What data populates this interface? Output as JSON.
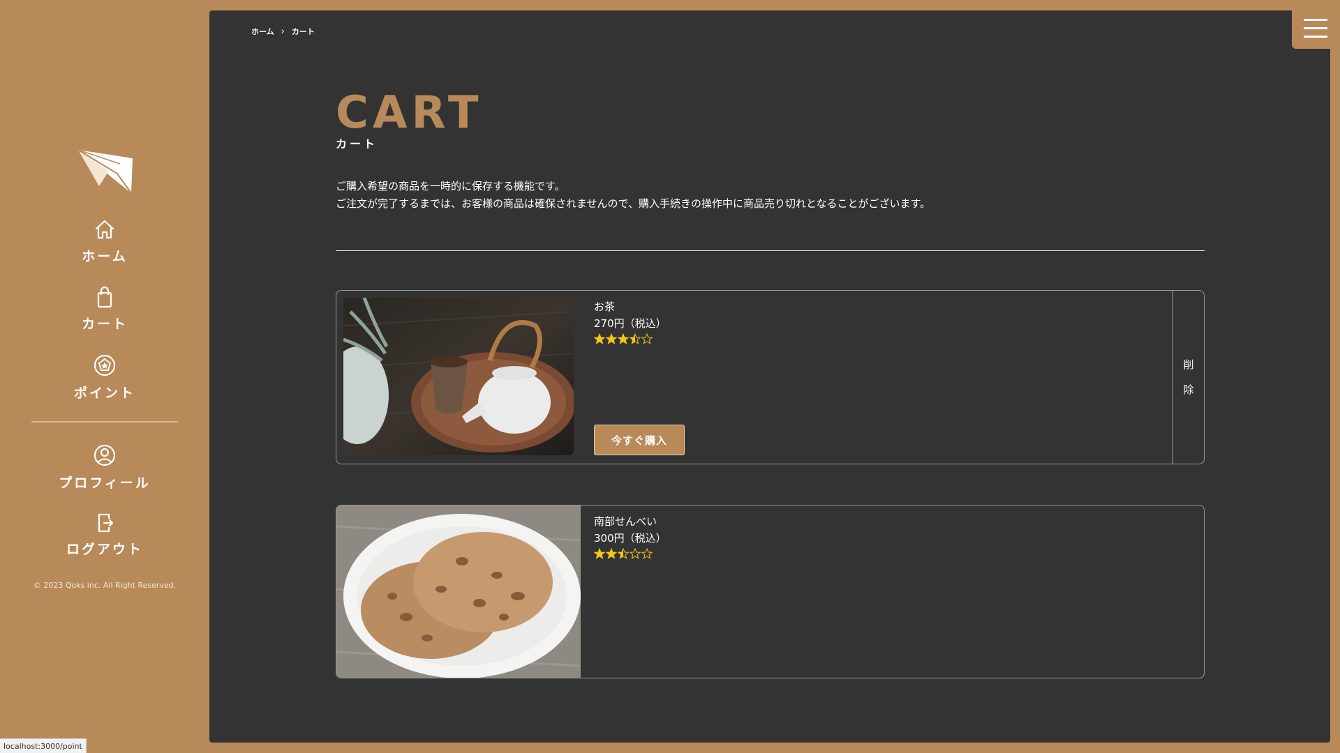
{
  "colors": {
    "accent": "#b88a5a",
    "panel": "#333333",
    "star": "#f5c518"
  },
  "sidebar": {
    "logo_icon": "paper-plane-icon",
    "items": [
      {
        "label": "ホーム",
        "icon": "home-icon"
      },
      {
        "label": "カート",
        "icon": "shopping-bag-icon"
      },
      {
        "label": "ポイント",
        "icon": "point-badge-icon"
      },
      {
        "label": "プロフィール",
        "icon": "user-circle-icon"
      },
      {
        "label": "ログアウト",
        "icon": "logout-icon"
      }
    ],
    "copyright": "© 2023 Qoks inc. All Right Reserved."
  },
  "breadcrumb": {
    "home": "ホーム",
    "separator": "›",
    "current": "カート"
  },
  "page": {
    "title": "CART",
    "subtitle": "カート",
    "description": [
      "ご購入希望の商品を一時的に保存する機能です。",
      "ご注文が完了するまでは、お客様の商品は確保されませんので、購入手続きの操作中に商品売り切れとなることがございます。"
    ]
  },
  "cart": {
    "items": [
      {
        "name": "お茶",
        "price": "270円（税込）",
        "rating": 3.5,
        "image": "teapot-photo",
        "buy_label": "今すぐ購入",
        "delete_label": [
          "削",
          "除"
        ]
      },
      {
        "name": "南部せんべい",
        "price": "300円（税込）",
        "rating": 2.5,
        "image": "senbei-cookie-photo"
      }
    ]
  },
  "menu_icon": "hamburger-menu-icon",
  "status_bar": {
    "url": "localhost:3000/point"
  }
}
